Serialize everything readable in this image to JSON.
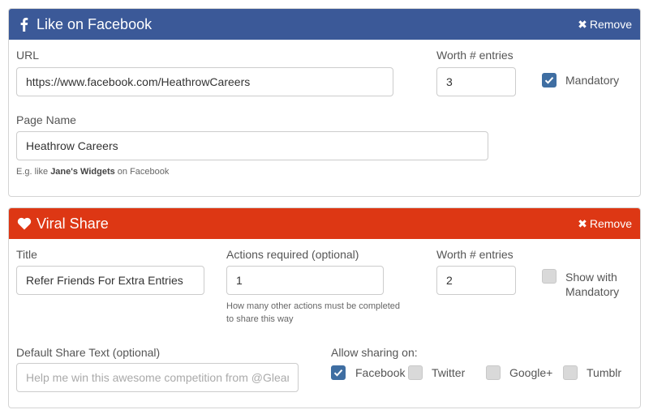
{
  "facebook": {
    "title": "Like on Facebook",
    "remove_label": "Remove",
    "url_label": "URL",
    "url_value": "https://www.facebook.com/HeathrowCareers",
    "worth_label": "Worth # entries",
    "worth_value": "3",
    "mandatory_label": "Mandatory",
    "mandatory_checked": true,
    "page_name_label": "Page Name",
    "page_name_value": "Heathrow Careers",
    "help_prefix": "E.g. like ",
    "help_bold": "Jane's Widgets",
    "help_suffix": " on Facebook",
    "color": "#3b5998"
  },
  "viral": {
    "title": "Viral Share",
    "remove_label": "Remove",
    "title_label": "Title",
    "title_value": "Refer Friends For Extra Entries",
    "actions_label": "Actions required (optional)",
    "actions_value": "1",
    "actions_help_line1": "How many other actions must be completed",
    "actions_help_line2": "to share this way",
    "worth_label": "Worth # entries",
    "worth_value": "2",
    "show_mandatory_line1": "Show with",
    "show_mandatory_line2": "Mandatory",
    "show_mandatory_checked": false,
    "share_text_label": "Default Share Text (optional)",
    "share_text_placeholder": "Help me win this awesome competition from @Gleamapp",
    "allow_label": "Allow sharing on:",
    "networks": [
      {
        "label": "Facebook",
        "checked": true
      },
      {
        "label": "Twitter",
        "checked": false
      },
      {
        "label": "Google+",
        "checked": false
      },
      {
        "label": "Tumblr",
        "checked": false
      }
    ],
    "color": "#dd3714"
  }
}
